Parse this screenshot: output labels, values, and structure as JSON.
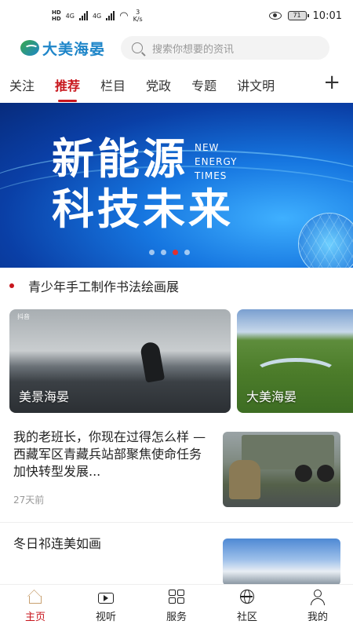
{
  "statusbar": {
    "network_top": "HD",
    "network_bottom": "HD",
    "sig1_label": "4G",
    "sig2_label": "4G",
    "speed_value": "3",
    "speed_unit": "K/s",
    "battery": "71",
    "time": "10:01"
  },
  "header": {
    "logo_text": "大美海晏",
    "search_placeholder": "搜索你想要的资讯"
  },
  "tabs": [
    {
      "label": "关注"
    },
    {
      "label": "推荐"
    },
    {
      "label": "栏目"
    },
    {
      "label": "党政"
    },
    {
      "label": "专题"
    },
    {
      "label": "讲文明"
    }
  ],
  "tab_add": "+",
  "banner": {
    "title_line1": "新能源",
    "title_line2": "科技未来",
    "sub_line1": "NEW",
    "sub_line2": "ENERGY",
    "sub_line3": "TIMES",
    "active_dot": 3,
    "dot_count": 4
  },
  "headline": "青少年手工制作书法绘画展",
  "video_cards": [
    {
      "label": "美景海晏",
      "tag": "抖音"
    },
    {
      "label": "大美海晏"
    }
  ],
  "news": [
    {
      "title": "我的老班长，你现在过得怎么样 —西藏军区青藏兵站部聚焦使命任务加快转型发展...",
      "time": "27天前"
    },
    {
      "title": "冬日祁连美如画"
    }
  ],
  "bottom_nav": [
    {
      "label": "主页",
      "icon": "home-icon"
    },
    {
      "label": "视听",
      "icon": "video-icon"
    },
    {
      "label": "服务",
      "icon": "grid-icon"
    },
    {
      "label": "社区",
      "icon": "globe-icon"
    },
    {
      "label": "我的",
      "icon": "user-icon"
    }
  ],
  "colors": {
    "accent": "#c8161d",
    "logo_blue": "#1f86c9"
  }
}
